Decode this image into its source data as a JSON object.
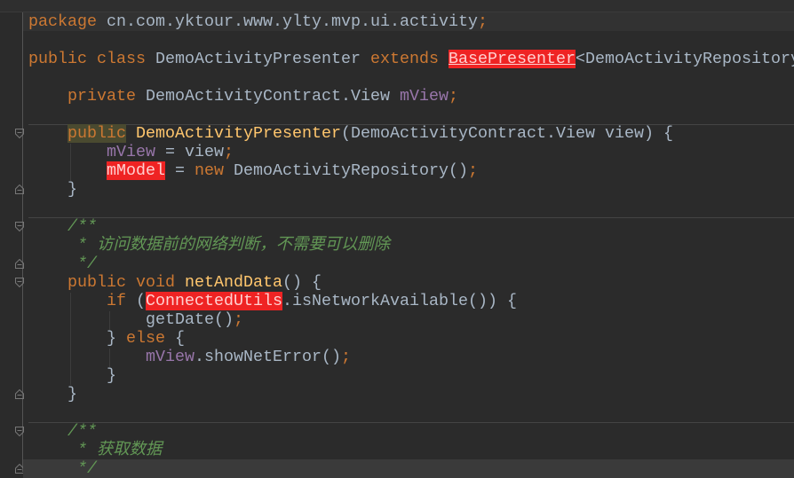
{
  "code": {
    "package_kw": "package",
    "package_name": " cn.com.yktour.www.ylty.mvp.ui.activity",
    "public": "public",
    "class": "class",
    "class_name": "DemoActivityPresenter",
    "extends": "extends",
    "base": "BasePresenter",
    "generic": "<DemoActivityRepository",
    "private": "private",
    "field_type": "DemoActivityContract.View",
    "field_name": "mView",
    "ctor_name": "DemoActivityPresenter",
    "ctor_params": "(DemoActivityContract.View view) {",
    "assign_rhs": " = view",
    "mModel": "mModel",
    "new": "new",
    "repo_ctor": " DemoActivityRepository()",
    "doc_open": "/**",
    "doc_comment1": " * 访问数据前的网络判断，不需要可以删除",
    "doc_close": " */",
    "void": "void",
    "method_name": "netAndData",
    "method_tail": "() {",
    "if": "if",
    "connected_utils": "ConnectedUtils",
    "if_tail": ".isNetworkAvailable()) {",
    "get_date": "getDate()",
    "else": "else",
    "show_error": ".showNetError()",
    "doc_comment2": " * 获取数据"
  }
}
